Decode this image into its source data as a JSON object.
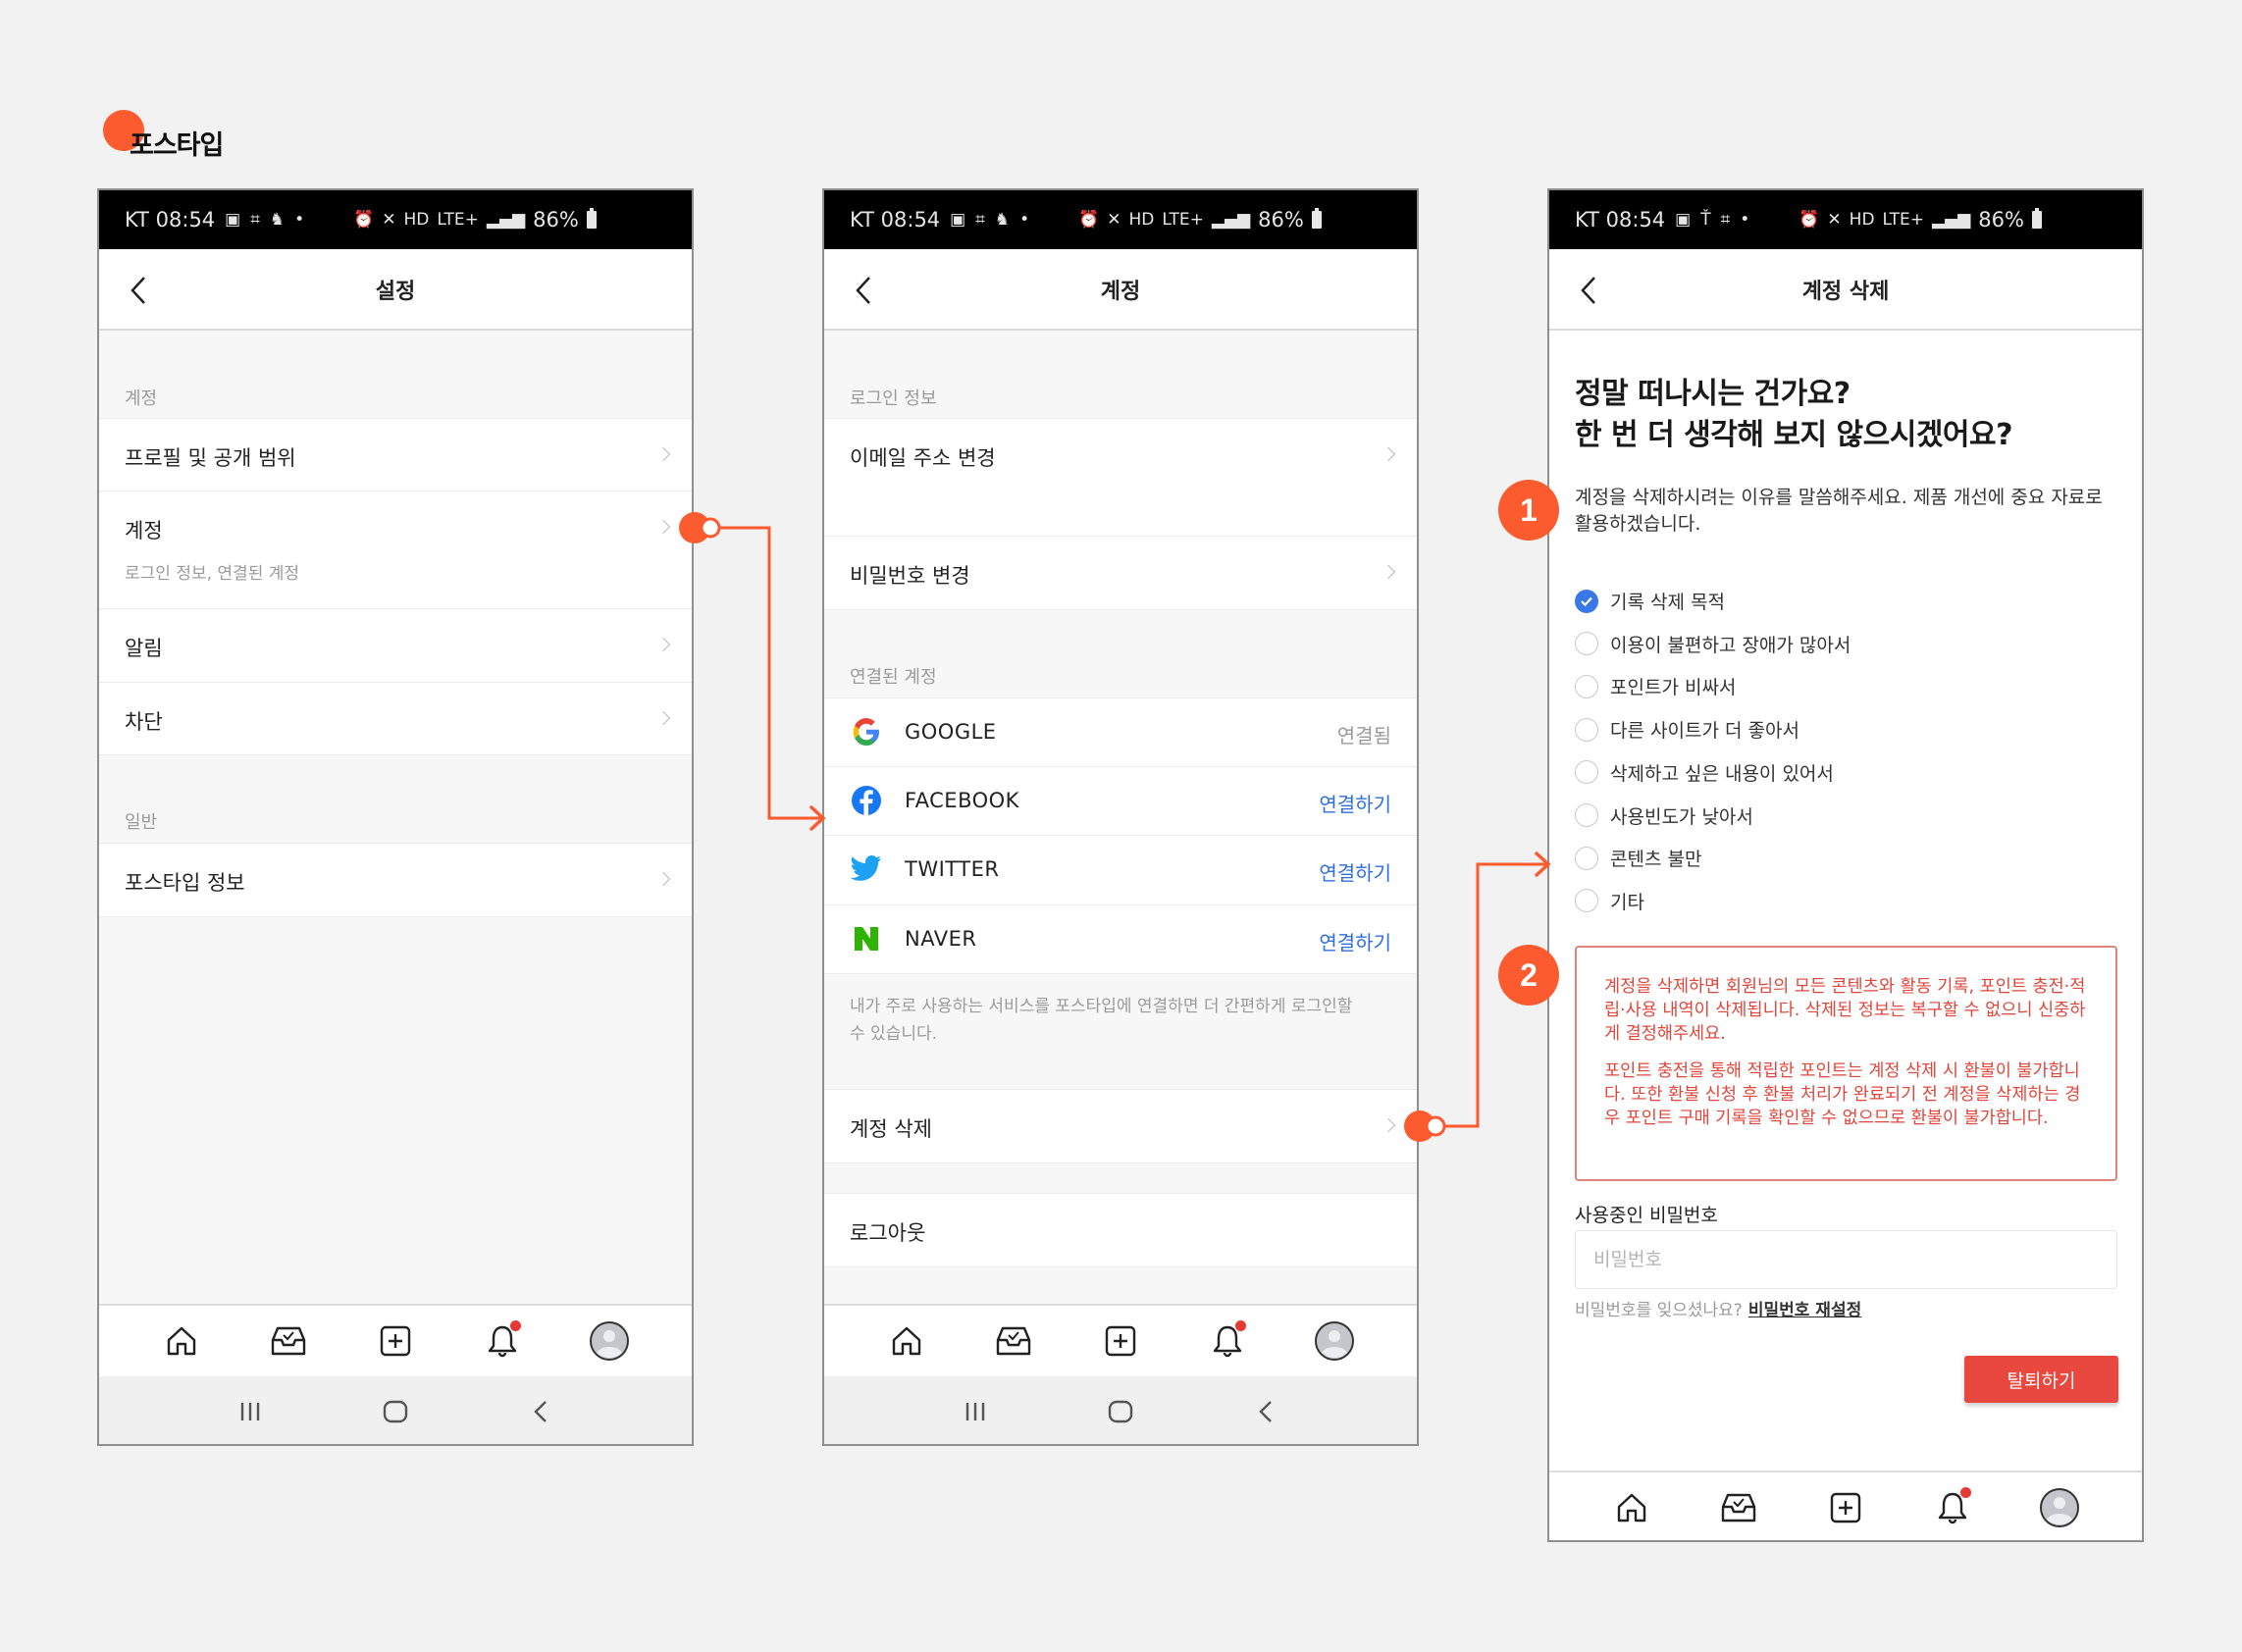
{
  "brand": {
    "title": "포스타입",
    "accent": "#fb5b2e"
  },
  "status_bar": {
    "carrier_time": "KT 08:54",
    "battery": "86%",
    "network": "LTE+"
  },
  "screens": {
    "settings": {
      "title": "설정",
      "sections": [
        {
          "label": "계정"
        },
        {
          "label": "일반"
        }
      ],
      "rows": [
        {
          "label": "프로필 및 공개 범위"
        },
        {
          "label": "계정",
          "sub": "로그인 정보, 연결된 계정"
        },
        {
          "label": "알림"
        },
        {
          "label": "차단"
        },
        {
          "label": "포스타입 정보"
        }
      ]
    },
    "account": {
      "title": "계정",
      "sections": [
        {
          "label": "로그인 정보"
        },
        {
          "label": "연결된 계정"
        }
      ],
      "rows": [
        {
          "label": "이메일 주소 변경"
        },
        {
          "label": "비밀번호 변경"
        },
        {
          "label": "계정 삭제"
        },
        {
          "label": "로그아웃"
        }
      ],
      "linked_accounts": [
        {
          "name": "GOOGLE",
          "icon": "google-icon",
          "status": "연결됨",
          "state": "connected"
        },
        {
          "name": "FACEBOOK",
          "icon": "facebook-icon",
          "status": "연결하기",
          "state": "connect"
        },
        {
          "name": "TWITTER",
          "icon": "twitter-icon",
          "status": "연결하기",
          "state": "connect"
        },
        {
          "name": "NAVER",
          "icon": "naver-icon",
          "status": "연결하기",
          "state": "connect"
        }
      ],
      "note": "내가 주로 사용하는 서비스를 포스타입에 연결하면 더 간편하게 로그인할 수 있습니다."
    },
    "delete": {
      "title": "계정 삭제",
      "heading_line1": "정말 떠나시는 건가요?",
      "heading_line2": "한 번 더 생각해 보지 않으시겠어요?",
      "description": "계정을 삭제하시려는 이유를 말씀해주세요. 제품 개선에 중요 자료로 활용하겠습니다.",
      "reasons": [
        {
          "label": "기록 삭제 목적",
          "checked": true
        },
        {
          "label": "이용이 불편하고 장애가 많아서",
          "checked": false
        },
        {
          "label": "포인트가 비싸서",
          "checked": false
        },
        {
          "label": "다른 사이트가 더 좋아서",
          "checked": false
        },
        {
          "label": "삭제하고 싶은 내용이 있어서",
          "checked": false
        },
        {
          "label": "사용빈도가 낮아서",
          "checked": false
        },
        {
          "label": "콘텐츠 불만",
          "checked": false
        },
        {
          "label": "기타",
          "checked": false
        }
      ],
      "warning_p1": "계정을 삭제하면 회원님의 모든 콘텐츠와 활동 기록, 포인트 충전·적립·사용 내역이 삭제됩니다. 삭제된 정보는 복구할 수 없으니 신중하게 결정해주세요.",
      "warning_p2": "포인트 충전을 통해 적립한 포인트는 계정 삭제 시 환불이 불가합니다. 또한 환불 신청 후 환불 처리가 완료되기 전 계정을 삭제하는 경우 포인트 구매 기록을 확인할 수 없으므로 환불이 불가합니다.",
      "password_label": "사용중인 비밀번호",
      "password_placeholder": "비밀번호",
      "password_value": "",
      "forgot_text": "비밀번호를 잊으셨나요?",
      "reset_link": "비밀번호 재설정",
      "withdraw_button": "탈퇴하기",
      "warning_color": "#e0463b",
      "button_color": "#e8483d"
    }
  },
  "tab_bar": {
    "items": [
      "home-icon",
      "inbox-icon",
      "add-post-icon",
      "notification-bell-icon",
      "profile-avatar"
    ],
    "notification_dot": true
  },
  "annotations": {
    "badges": [
      "1",
      "2"
    ],
    "color": "#fb5b2e"
  }
}
